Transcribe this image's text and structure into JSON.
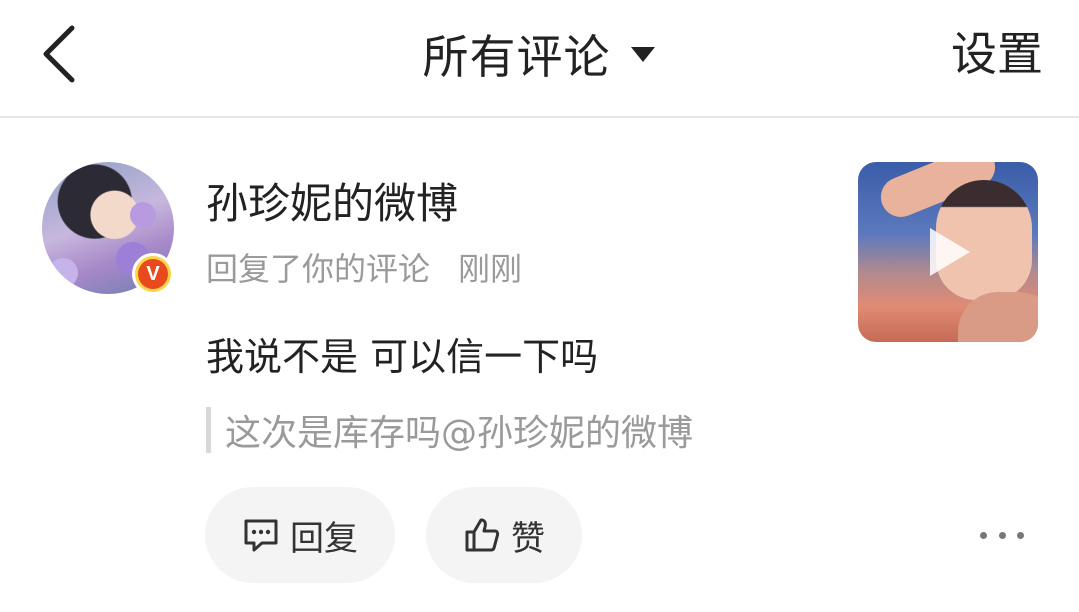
{
  "header": {
    "back_icon": "chevron-left-icon",
    "title": "所有评论",
    "dropdown_icon": "caret-down-icon",
    "settings_label": "设置"
  },
  "comment": {
    "username": "孙珍妮的微博",
    "verified_badge": "V",
    "action_text": "回复了你的评论",
    "time": "刚刚",
    "text": "我说不是 可以信一下吗",
    "quoted_text": "这次是库存吗@孙珍妮的微博",
    "thumbnail_icon": "play-icon"
  },
  "actions": {
    "reply_label": "回复",
    "like_label": "赞",
    "more_icon": "more-icon"
  },
  "colors": {
    "badge_outer": "#f7d548",
    "badge_inner": "#e8491d",
    "muted_text": "#9a9a9a",
    "pill_bg": "#f4f4f4"
  }
}
